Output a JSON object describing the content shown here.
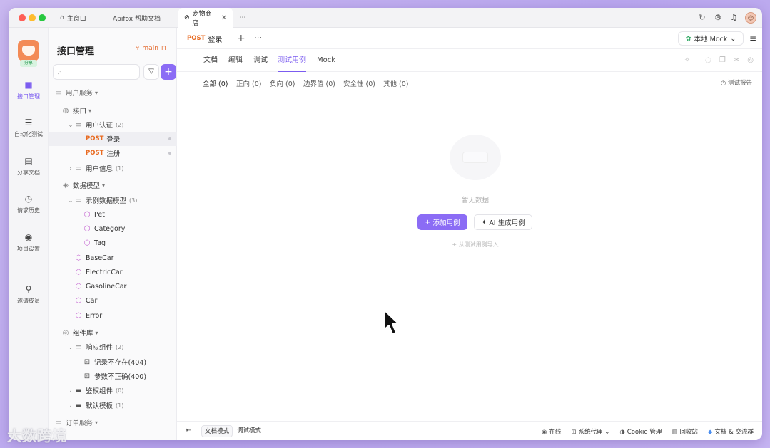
{
  "titlebar": {
    "tabs": [
      {
        "label": "主窗口",
        "icon": "home-icon"
      },
      {
        "label": "Apifox 帮助文档"
      },
      {
        "label": "宠物商店",
        "icon": "link-icon",
        "active": true
      },
      {
        "label": "⋯"
      }
    ]
  },
  "rail": {
    "badge": "分享",
    "items": [
      {
        "label": "接口管理",
        "icon": "api-icon",
        "active": true
      },
      {
        "label": "自动化测试",
        "icon": "automation-icon"
      },
      {
        "label": "分享文档",
        "icon": "book-icon"
      },
      {
        "label": "请求历史",
        "icon": "history-icon"
      },
      {
        "label": "项目设置",
        "icon": "settings-icon"
      },
      {
        "label": "邀请成员",
        "icon": "invite-icon"
      }
    ]
  },
  "sidebar": {
    "title": "接口管理",
    "branch": "main",
    "tree": [
      {
        "label": "用户服务",
        "kind": "section",
        "depth": 0
      },
      {
        "label": "接口",
        "kind": "group",
        "depth": 1
      },
      {
        "label": "用户认证",
        "count": "(2)",
        "kind": "folder",
        "depth": 2,
        "expanded": true
      },
      {
        "method": "POST",
        "label": "登录",
        "kind": "endpoint",
        "depth": 3,
        "selected": true
      },
      {
        "method": "POST",
        "label": "注册",
        "kind": "endpoint",
        "depth": 3
      },
      {
        "label": "用户信息",
        "count": "(1)",
        "kind": "folder",
        "depth": 2,
        "expanded": false
      },
      {
        "label": "数据模型",
        "kind": "group",
        "depth": 1
      },
      {
        "label": "示例数据模型",
        "count": "(3)",
        "kind": "folder",
        "depth": 2,
        "expanded": true
      },
      {
        "label": "Pet",
        "kind": "model",
        "depth": 3
      },
      {
        "label": "Category",
        "kind": "model",
        "depth": 3
      },
      {
        "label": "Tag",
        "kind": "model",
        "depth": 3
      },
      {
        "label": "BaseCar",
        "kind": "model",
        "depth": 2
      },
      {
        "label": "ElectricCar",
        "kind": "model",
        "depth": 2
      },
      {
        "label": "GasolineCar",
        "kind": "model",
        "depth": 2
      },
      {
        "label": "Car",
        "kind": "model",
        "depth": 2
      },
      {
        "label": "Error",
        "kind": "model",
        "depth": 2
      },
      {
        "label": "组件库",
        "kind": "group",
        "depth": 1
      },
      {
        "label": "响应组件",
        "count": "(2)",
        "kind": "folder",
        "depth": 2,
        "expanded": true
      },
      {
        "label": "记录不存在(404)",
        "kind": "response",
        "depth": 3
      },
      {
        "label": "参数不正确(400)",
        "kind": "response",
        "depth": 3
      },
      {
        "label": "鉴权组件",
        "count": "(0)",
        "kind": "folder",
        "depth": 2,
        "expanded": false
      },
      {
        "label": "默认模板",
        "count": "(1)",
        "kind": "folder",
        "depth": 2,
        "expanded": false
      },
      {
        "label": "订单服务",
        "kind": "section",
        "depth": 0
      }
    ]
  },
  "doc_tab": {
    "method": "POST",
    "label": "登录"
  },
  "env": {
    "label": "本地 Mock"
  },
  "sub_tabs": [
    "文档",
    "编辑",
    "调试",
    "测试用例",
    "Mock"
  ],
  "filters": [
    "全部 (0)",
    "正向 (0)",
    "负向 (0)",
    "边界值 (0)",
    "安全性 (0)",
    "其他 (0)"
  ],
  "report_label": "测试报告",
  "empty": {
    "text": "暂无数据",
    "add_button": "添加用例",
    "ai_button": "AI 生成用例",
    "import_link": "从测试用例导入"
  },
  "statusbar": {
    "modes": [
      "文档模式",
      "调试模式"
    ],
    "right": [
      {
        "label": "在线",
        "icon": "online-icon"
      },
      {
        "label": "系统代理",
        "icon": "proxy-icon"
      },
      {
        "label": "Cookie 管理",
        "icon": "cookie-icon"
      },
      {
        "label": "回收站",
        "icon": "trash-icon"
      },
      {
        "label": "文档 & 交流群",
        "icon": "docs-icon"
      }
    ]
  },
  "watermark": "大数跨境",
  "colors": {
    "accent": "#8b6cf5",
    "method_post": "#e86b22",
    "model_icon": "#c25ccf"
  }
}
